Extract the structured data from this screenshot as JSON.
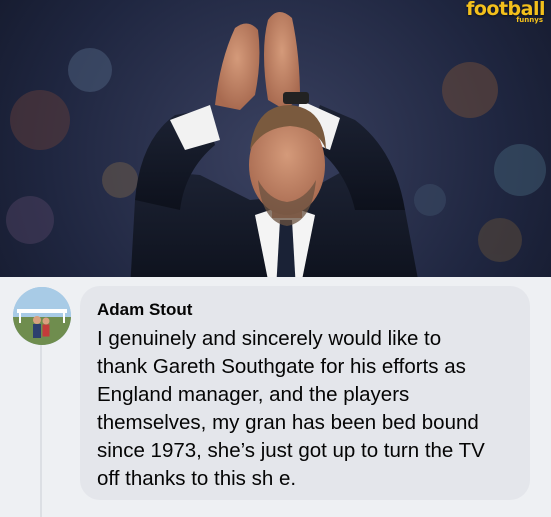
{
  "watermark": {
    "brand": "football",
    "sub": "funnys",
    "color": "#f3c01c"
  },
  "photo": {
    "subject_icon": "applauding-man-photo"
  },
  "comment": {
    "avatar_icon": "profile-avatar-icon",
    "author": "Adam Stout",
    "lines": [
      "I genuinely and sincerely would like to",
      "thank Gareth Southgate for his efforts as",
      "England manager, and the players",
      "themselves, my gran has been bed bound",
      "since 1973, she’s just got up to turn the TV",
      "off thanks to this sh  e."
    ],
    "bubble_color": "#e4e6eb",
    "text_color": "#050505"
  }
}
